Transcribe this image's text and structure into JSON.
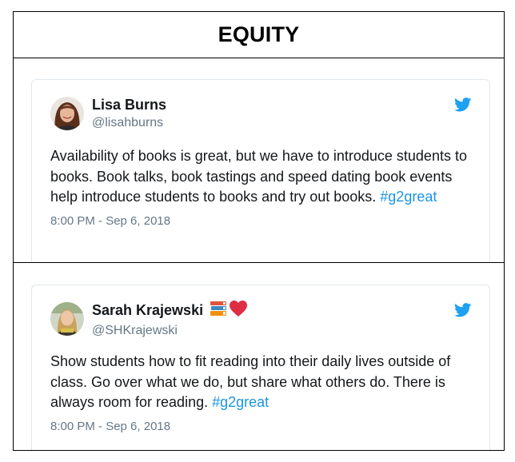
{
  "header": {
    "title": "EQUITY"
  },
  "tweets": [
    {
      "name": "Lisa Burns",
      "handle": "@lisahburns",
      "text": "Availability of books is great, but we have to introduce students to books. Book talks, book tastings and speed dating book events help introduce students to books and try out books.",
      "hashtag": "#g2great",
      "timestamp": "8:00 PM - Sep 6, 2018",
      "avatar_icon": "avatar-lisa-burns",
      "brand_icon": "twitter-bird-icon",
      "accent_color": "#1da1f2"
    },
    {
      "name": "Sarah Krajewski",
      "name_emoji": [
        "books-emoji",
        "red-heart-emoji"
      ],
      "handle": "@SHKrajewski",
      "text": "Show students how to fit reading into their daily lives outside of class. Go over what we do, but share what others do. There is always room for reading.",
      "hashtag": "#g2great",
      "timestamp": "8:00 PM - Sep 6, 2018",
      "avatar_icon": "avatar-sarah-krajewski",
      "brand_icon": "twitter-bird-icon",
      "accent_color": "#1da1f2"
    }
  ]
}
